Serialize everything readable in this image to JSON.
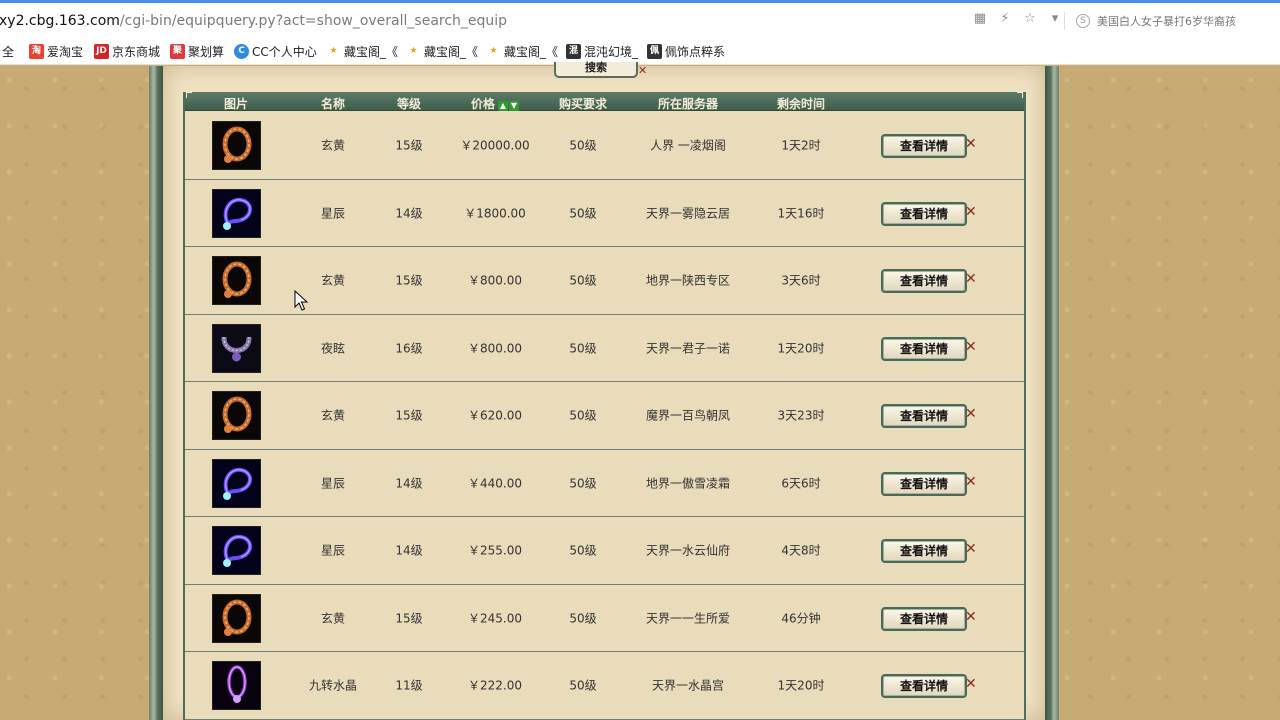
{
  "browser": {
    "url_host": "xy2.cbg.163.com",
    "url_path": "/cgi-bin/equipquery.py?act=show_overall_search_equip",
    "search_suggestion": "美国白人女子暴打6岁华裔孩",
    "bookmarks": [
      {
        "label": "全",
        "icon": ""
      },
      {
        "label": "爱淘宝",
        "icon": "淘"
      },
      {
        "label": "京东商城",
        "icon": "JD"
      },
      {
        "label": "聚划算",
        "icon": "聚"
      },
      {
        "label": "CC个人中心",
        "icon": "C"
      },
      {
        "label": "藏宝阁_《",
        "icon": "★"
      },
      {
        "label": "藏宝阁_《",
        "icon": "★"
      },
      {
        "label": "藏宝阁_《",
        "icon": "★"
      },
      {
        "label": "混沌幻境_",
        "icon": "混"
      },
      {
        "label": "佩饰点粹系",
        "icon": "佩"
      }
    ]
  },
  "search_button_label": "搜索",
  "table": {
    "headers": {
      "image": "图片",
      "name": "名称",
      "level": "等级",
      "price": "价格",
      "requirement": "购买要求",
      "server": "所在服务器",
      "time_left": "剩余时间"
    },
    "detail_label": "查看详情",
    "rows": [
      {
        "icon": "amber-necklace",
        "name": "玄黄",
        "level": "15级",
        "price": "￥20000.00",
        "req": "50级",
        "server": "人界 一凌烟阁",
        "time": "1天2时"
      },
      {
        "icon": "blue-necklace",
        "name": "星辰",
        "level": "14级",
        "price": "￥1800.00",
        "req": "50级",
        "server": "天界一雾隐云居",
        "time": "1天16时"
      },
      {
        "icon": "amber-necklace",
        "name": "玄黄",
        "level": "15级",
        "price": "￥800.00",
        "req": "50级",
        "server": "地界一陕西专区",
        "time": "3天6时"
      },
      {
        "icon": "violet-necklace",
        "name": "夜眩",
        "level": "16级",
        "price": "￥800.00",
        "req": "50级",
        "server": "天界一君子一诺",
        "time": "1天20时"
      },
      {
        "icon": "amber-necklace",
        "name": "玄黄",
        "level": "15级",
        "price": "￥620.00",
        "req": "50级",
        "server": "魔界一百鸟朝凤",
        "time": "3天23时"
      },
      {
        "icon": "blue-necklace",
        "name": "星辰",
        "level": "14级",
        "price": "￥440.00",
        "req": "50级",
        "server": "地界一傲雪凌霜",
        "time": "6天6时"
      },
      {
        "icon": "blue-necklace",
        "name": "星辰",
        "level": "14级",
        "price": "￥255.00",
        "req": "50级",
        "server": "天界一水云仙府",
        "time": "4天8时"
      },
      {
        "icon": "amber-necklace",
        "name": "玄黄",
        "level": "15级",
        "price": "￥245.00",
        "req": "50级",
        "server": "天界一一生所爱",
        "time": "46分钟"
      },
      {
        "icon": "purple-crystal-necklace",
        "name": "九转水晶",
        "level": "11级",
        "price": "￥222.00",
        "req": "50级",
        "server": "天界一水晶宫",
        "time": "1天20时"
      }
    ]
  }
}
